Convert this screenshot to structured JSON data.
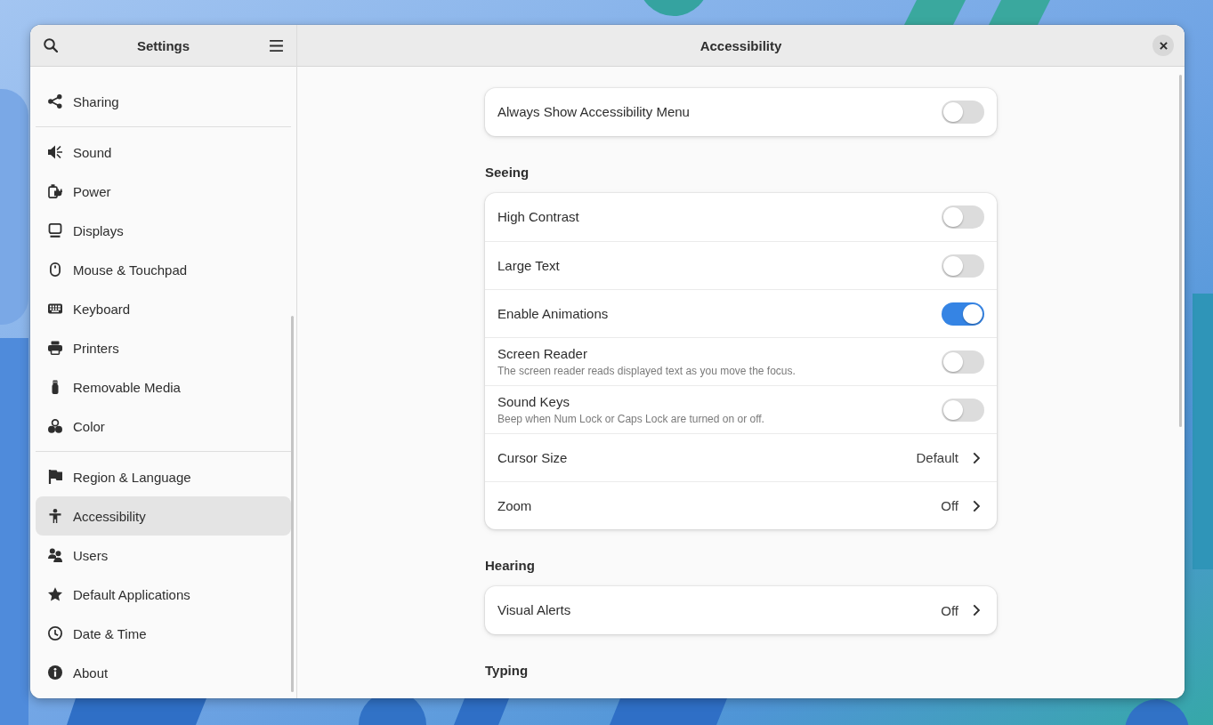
{
  "sidebar": {
    "title": "Settings",
    "groups": [
      {
        "items": [
          {
            "label": "Sharing",
            "selected": false
          }
        ]
      },
      {
        "items": [
          {
            "label": "Sound",
            "selected": false
          },
          {
            "label": "Power",
            "selected": false
          },
          {
            "label": "Displays",
            "selected": false
          },
          {
            "label": "Mouse & Touchpad",
            "selected": false
          },
          {
            "label": "Keyboard",
            "selected": false
          },
          {
            "label": "Printers",
            "selected": false
          },
          {
            "label": "Removable Media",
            "selected": false
          },
          {
            "label": "Color",
            "selected": false
          }
        ]
      },
      {
        "items": [
          {
            "label": "Region & Language",
            "selected": false
          },
          {
            "label": "Accessibility",
            "selected": true
          },
          {
            "label": "Users",
            "selected": false
          },
          {
            "label": "Default Applications",
            "selected": false
          },
          {
            "label": "Date & Time",
            "selected": false
          },
          {
            "label": "About",
            "selected": false
          }
        ]
      }
    ]
  },
  "page": {
    "title": "Accessibility"
  },
  "sections": [
    {
      "rows": [
        {
          "kind": "switch",
          "title": "Always Show Accessibility Menu",
          "on": false
        }
      ]
    },
    {
      "heading": "Seeing",
      "rows": [
        {
          "kind": "switch",
          "title": "High Contrast",
          "on": false
        },
        {
          "kind": "switch",
          "title": "Large Text",
          "on": false
        },
        {
          "kind": "switch",
          "title": "Enable Animations",
          "on": true
        },
        {
          "kind": "switch",
          "title": "Screen Reader",
          "subtitle": "The screen reader reads displayed text as you move the focus.",
          "on": false
        },
        {
          "kind": "switch",
          "title": "Sound Keys",
          "subtitle": "Beep when Num Lock or Caps Lock are turned on or off.",
          "on": false
        },
        {
          "kind": "link",
          "title": "Cursor Size",
          "value": "Default"
        },
        {
          "kind": "link",
          "title": "Zoom",
          "value": "Off"
        }
      ]
    },
    {
      "heading": "Hearing",
      "rows": [
        {
          "kind": "link",
          "title": "Visual Alerts",
          "value": "Off"
        }
      ]
    },
    {
      "heading": "Typing"
    }
  ]
}
